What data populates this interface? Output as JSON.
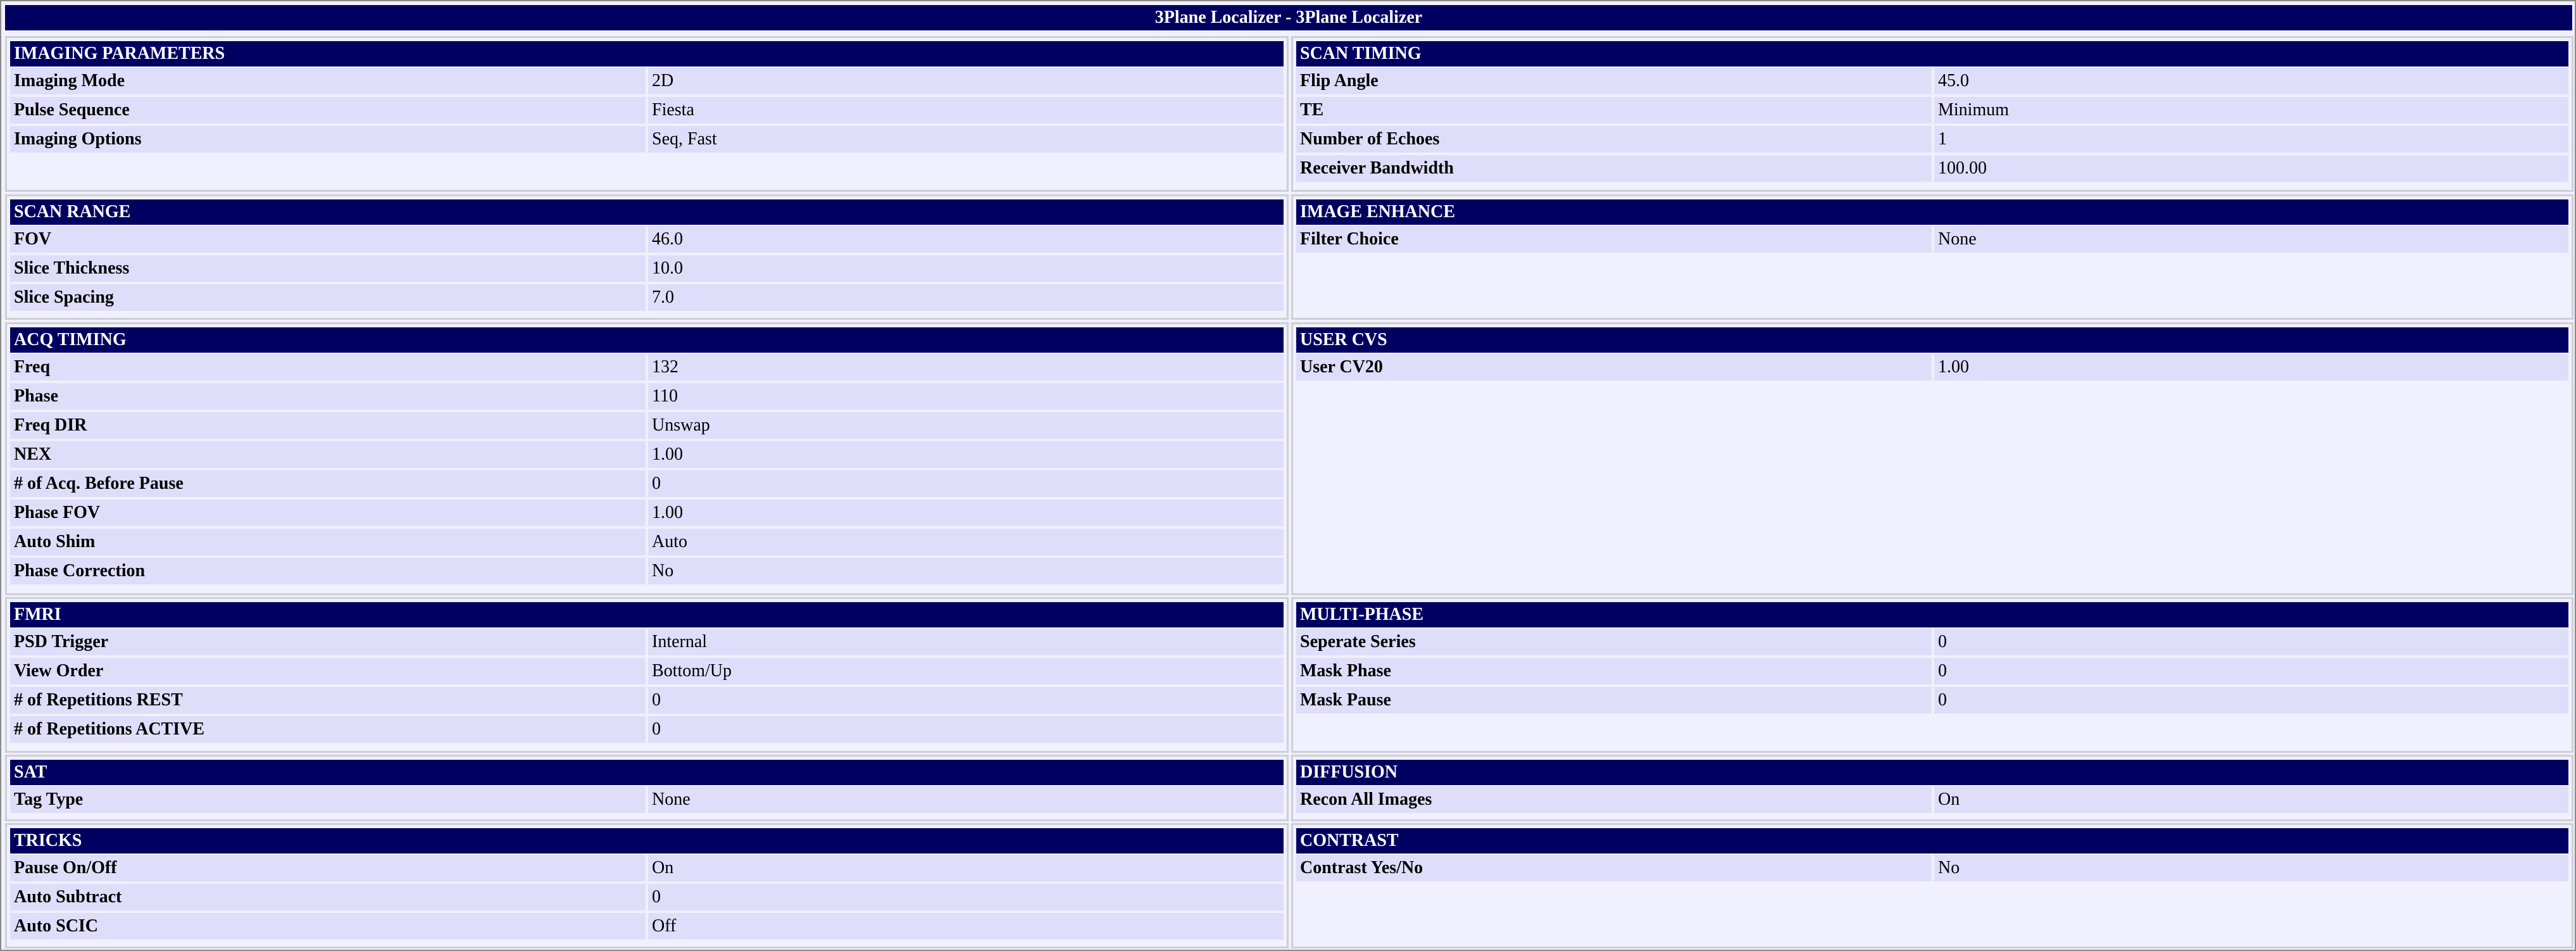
{
  "title": "3Plane Localizer - 3Plane Localizer",
  "sections": [
    {
      "id": "imaging-parameters",
      "heading": "IMAGING PARAMETERS",
      "rows": [
        {
          "label": "Imaging Mode",
          "value": "2D"
        },
        {
          "label": "Pulse Sequence",
          "value": "Fiesta"
        },
        {
          "label": "Imaging Options",
          "value": "Seq, Fast"
        }
      ]
    },
    {
      "id": "scan-timing",
      "heading": "SCAN TIMING",
      "rows": [
        {
          "label": "Flip Angle",
          "value": "45.0"
        },
        {
          "label": "TE",
          "value": "Minimum"
        },
        {
          "label": "Number of Echoes",
          "value": "1"
        },
        {
          "label": "Receiver Bandwidth",
          "value": "100.00"
        }
      ]
    },
    {
      "id": "scan-range",
      "heading": "SCAN RANGE",
      "rows": [
        {
          "label": "FOV",
          "value": "46.0"
        },
        {
          "label": "Slice Thickness",
          "value": "10.0"
        },
        {
          "label": "Slice Spacing",
          "value": "7.0"
        }
      ]
    },
    {
      "id": "image-enhance",
      "heading": "IMAGE ENHANCE",
      "rows": [
        {
          "label": "Filter Choice",
          "value": "None"
        }
      ]
    },
    {
      "id": "acq-timing",
      "heading": "ACQ TIMING",
      "rows": [
        {
          "label": "Freq",
          "value": "132"
        },
        {
          "label": "Phase",
          "value": "110"
        },
        {
          "label": "Freq DIR",
          "value": "Unswap"
        },
        {
          "label": "NEX",
          "value": "1.00"
        },
        {
          "label": "# of Acq. Before Pause",
          "value": "0"
        },
        {
          "label": "Phase FOV",
          "value": "1.00"
        },
        {
          "label": "Auto Shim",
          "value": "Auto"
        },
        {
          "label": "Phase Correction",
          "value": "No"
        }
      ]
    },
    {
      "id": "user-cvs",
      "heading": "USER CVS",
      "rows": [
        {
          "label": "User CV20",
          "value": "1.00"
        }
      ]
    },
    {
      "id": "fmri",
      "heading": "FMRI",
      "rows": [
        {
          "label": "PSD Trigger",
          "value": "Internal"
        },
        {
          "label": "View Order",
          "value": "Bottom/Up"
        },
        {
          "label": "# of Repetitions REST",
          "value": "0"
        },
        {
          "label": "# of Repetitions ACTIVE",
          "value": "0"
        }
      ]
    },
    {
      "id": "multi-phase",
      "heading": "MULTI-PHASE",
      "rows": [
        {
          "label": "Seperate Series",
          "value": "0"
        },
        {
          "label": "Mask Phase",
          "value": "0"
        },
        {
          "label": "Mask Pause",
          "value": "0"
        }
      ]
    },
    {
      "id": "sat",
      "heading": "SAT",
      "rows": [
        {
          "label": "Tag Type",
          "value": "None"
        }
      ]
    },
    {
      "id": "diffusion",
      "heading": "DIFFUSION",
      "rows": [
        {
          "label": "Recon All Images",
          "value": "On"
        }
      ]
    },
    {
      "id": "tricks",
      "heading": "TRICKS",
      "rows": [
        {
          "label": "Pause On/Off",
          "value": "On"
        },
        {
          "label": "Auto Subtract",
          "value": "0"
        },
        {
          "label": "Auto SCIC",
          "value": "Off"
        }
      ]
    },
    {
      "id": "contrast",
      "heading": "CONTRAST",
      "rows": [
        {
          "label": "Contrast Yes/No",
          "value": "No"
        }
      ]
    }
  ]
}
